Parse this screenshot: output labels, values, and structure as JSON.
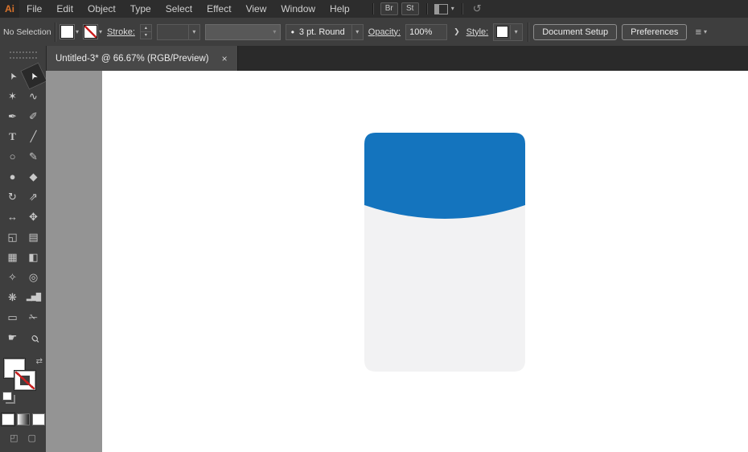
{
  "menubar": {
    "logo": "Ai",
    "menus": [
      "File",
      "Edit",
      "Object",
      "Type",
      "Select",
      "Effect",
      "View",
      "Window",
      "Help"
    ],
    "buttons": [
      {
        "name": "bridge-button",
        "label": "Br"
      },
      {
        "name": "stock-button",
        "label": "St"
      }
    ]
  },
  "controlbar": {
    "selection_status": "No Selection",
    "stroke_label": "Stroke:",
    "stroke_value": "",
    "brush_value": "3 pt. Round",
    "opacity_label": "Opacity:",
    "opacity_value": "100%",
    "style_label": "Style:",
    "document_setup_label": "Document Setup",
    "preferences_label": "Preferences"
  },
  "tabbar": {
    "active_tab": "Untitled-3* @ 66.67% (RGB/Preview)",
    "close_label": "×"
  },
  "toolbar": {
    "tools": [
      {
        "name": "selection-tool",
        "active": false
      },
      {
        "name": "direct-selection-tool",
        "active": true
      },
      {
        "name": "magic-wand-tool",
        "active": false
      },
      {
        "name": "lasso-tool",
        "active": false
      },
      {
        "name": "pen-tool",
        "active": false
      },
      {
        "name": "paintbrush-tool",
        "active": false
      },
      {
        "name": "type-tool",
        "active": false
      },
      {
        "name": "line-tool",
        "active": false
      },
      {
        "name": "ellipse-tool",
        "active": false
      },
      {
        "name": "pencil-tool",
        "active": false
      },
      {
        "name": "blob-brush-tool",
        "active": false
      },
      {
        "name": "eraser-tool",
        "active": false
      },
      {
        "name": "rotate-tool",
        "active": false
      },
      {
        "name": "scale-tool",
        "active": false
      },
      {
        "name": "width-tool",
        "active": false
      },
      {
        "name": "free-transform-tool",
        "active": false
      },
      {
        "name": "shape-builder-tool",
        "active": false
      },
      {
        "name": "perspective-grid-tool",
        "active": false
      },
      {
        "name": "mesh-tool",
        "active": false
      },
      {
        "name": "gradient-tool",
        "active": false
      },
      {
        "name": "eyedropper-tool",
        "active": false
      },
      {
        "name": "blend-tool",
        "active": false
      },
      {
        "name": "symbol-sprayer-tool",
        "active": false
      },
      {
        "name": "column-graph-tool",
        "active": false
      },
      {
        "name": "artboard-tool",
        "active": false
      },
      {
        "name": "slice-tool",
        "active": false
      },
      {
        "name": "hand-tool",
        "active": false
      },
      {
        "name": "zoom-tool",
        "active": false
      }
    ]
  },
  "icons": {
    "chevron_down": "▾",
    "stepper_up": "▴",
    "stepper_down": "▾",
    "expand_arrow": "❯",
    "swap": "⇄",
    "cs_live": "↺",
    "arrange": "≡",
    "drawing_mode": "◰",
    "screen_mode": "▢",
    "brush_dot": "•"
  },
  "canvas": {
    "shape": {
      "lid_color": "#1474BE",
      "body_color": "#F2F2F3"
    }
  }
}
